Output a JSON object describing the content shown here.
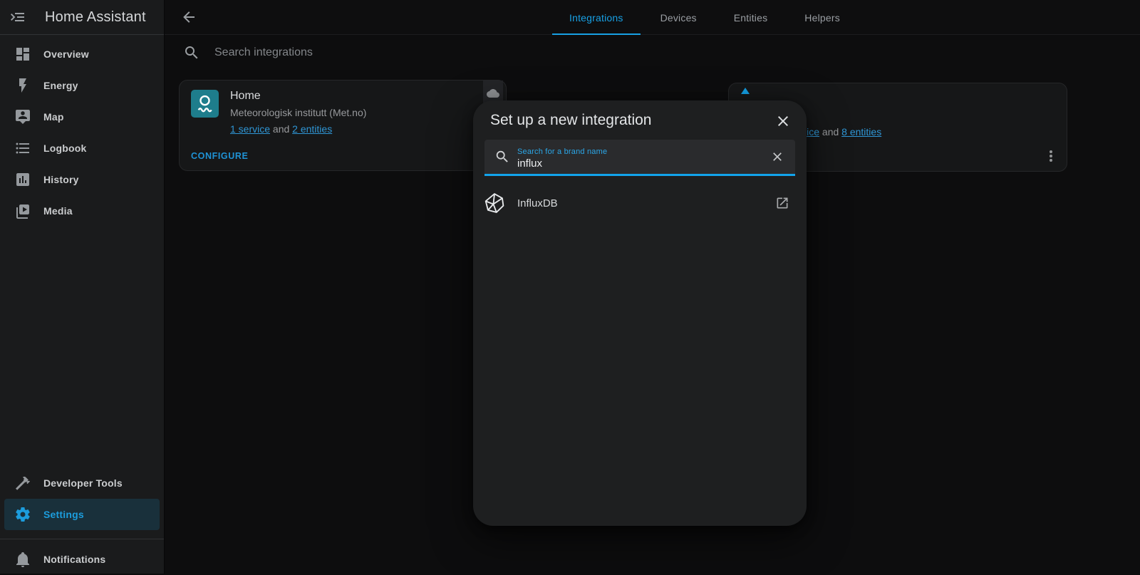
{
  "app": {
    "title": "Home Assistant"
  },
  "sidebar": {
    "items": [
      {
        "label": "Overview",
        "icon": "view-dashboard"
      },
      {
        "label": "Energy",
        "icon": "lightning-bolt"
      },
      {
        "label": "Map",
        "icon": "tooltip-account"
      },
      {
        "label": "Logbook",
        "icon": "format-list-bulleted"
      },
      {
        "label": "History",
        "icon": "chart-box"
      },
      {
        "label": "Media",
        "icon": "play-box-multiple"
      }
    ],
    "bottom_items": [
      {
        "label": "Developer Tools",
        "icon": "hammer",
        "active": false
      },
      {
        "label": "Settings",
        "icon": "cog",
        "active": true
      },
      {
        "label": "Notifications",
        "icon": "bell",
        "active": false
      }
    ]
  },
  "header": {
    "tabs": [
      {
        "label": "Integrations",
        "active": true
      },
      {
        "label": "Devices",
        "active": false
      },
      {
        "label": "Entities",
        "active": false
      },
      {
        "label": "Helpers",
        "active": false
      }
    ]
  },
  "toolbar": {
    "search_placeholder": "Search integrations"
  },
  "cards": {
    "met": {
      "title": "Home",
      "subtitle": "Meteorologisk institutt (Met.no)",
      "service_link": "1 service",
      "and_text": "and",
      "entities_link": "2 entities",
      "action_label": "CONFIGURE",
      "badge_icon": "cloud"
    },
    "partial": {
      "service_link": "1 service",
      "and_text": "and",
      "entities_link": "8 entities"
    }
  },
  "dialog": {
    "title": "Set up a new integration",
    "search": {
      "label": "Search for a brand name",
      "value": "influx"
    },
    "results": [
      {
        "name": "InfluxDB",
        "icon": "influxdb-logo",
        "action_icon": "open-in-new"
      }
    ]
  },
  "colors": {
    "accent": "#18a0e4",
    "link": "#2f96d5",
    "metno_teal": "#1e7d8c",
    "sidebar_bg": "#1a1b1c",
    "dialog_bg": "#1e1f20"
  }
}
